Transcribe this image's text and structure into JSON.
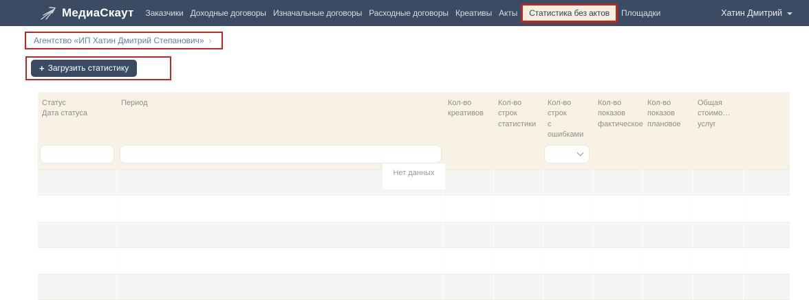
{
  "navbar": {
    "brand": "МедиаСкаут",
    "items": [
      "Заказчики",
      "Доходные договоры",
      "Изначальные договоры",
      "Расходные договоры",
      "Креативы",
      "Акты"
    ],
    "active_item": "Статистика без актов",
    "items_after": [
      "Площадки"
    ],
    "user": "Хатин Дмитрий"
  },
  "breadcrumb": {
    "label": "Агентство «ИП Хатин Дмитрий Степанович»",
    "chevron": "›"
  },
  "toolbar": {
    "plus_icon": "+",
    "upload_label": "Загрузить статистику"
  },
  "table": {
    "columns": [
      {
        "line1": "Статус",
        "line2": "Дата статуса"
      },
      {
        "line1": "Период",
        "line2": ""
      },
      {
        "line1": "Кол-во",
        "line2": "креативов"
      },
      {
        "line1": "Кол-во строк",
        "line2": "статистики"
      },
      {
        "line1": "Кол-во строк",
        "line2": "с ошибками"
      },
      {
        "line1": "Кол-во показов",
        "line2": "фактическое"
      },
      {
        "line1": "Кол-во показов",
        "line2": "плановое"
      },
      {
        "line1": "Общая стоимо…",
        "line2": "услуг"
      },
      {
        "line1": "",
        "line2": ""
      }
    ],
    "filters": {
      "status_value": "",
      "period_value": "",
      "errors_value": ""
    },
    "empty_text": "Нет данных"
  },
  "colors": {
    "navbar_bg": "#3c4b64",
    "active_pill_bg": "#f6eede",
    "table_header_bg": "#f8f1e6",
    "annotation_red": "#bf281d",
    "link_blue": "#5d80a7"
  }
}
